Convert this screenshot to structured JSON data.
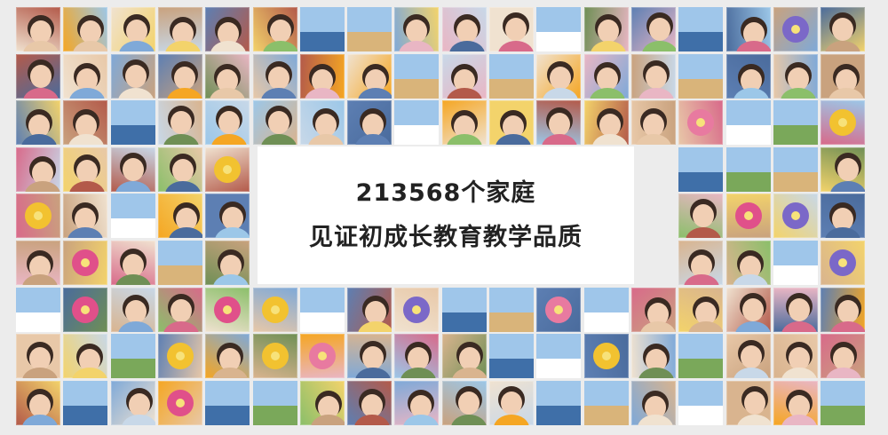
{
  "headline": {
    "line1": "213568个家庭",
    "line2": "见证初成长教育教学品质"
  },
  "mosaic": {
    "description_icon": "family-photo-tile",
    "palette": [
      "#c9a27e",
      "#e8c8a8",
      "#7fa9d8",
      "#f3d36b",
      "#d86a8a",
      "#8bbf6a",
      "#5d7fb3",
      "#f0e2d0",
      "#b35a4a",
      "#9cc7e8",
      "#e9b6c4",
      "#6f8f55",
      "#d9b48f",
      "#4a6b9c",
      "#f5a623",
      "#c8d8e8"
    ]
  }
}
